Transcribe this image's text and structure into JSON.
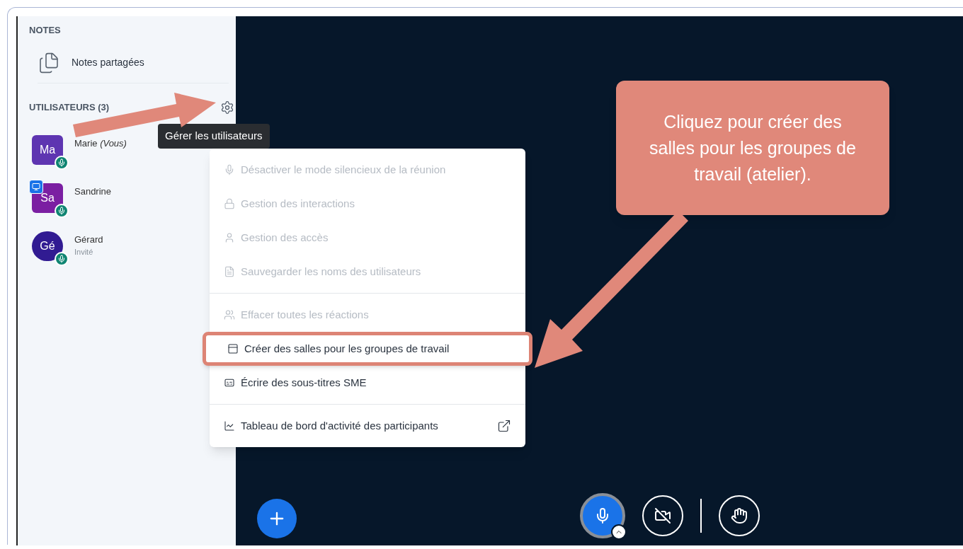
{
  "sidebar": {
    "notes_heading": "NOTES",
    "notes_item": "Notes partagées",
    "users_heading": "UTILISATEURS (3)",
    "users": [
      {
        "initials": "Ma",
        "name": "Marie *(Vous)*",
        "kind": "square",
        "color": "#5e35b1",
        "presenter": false
      },
      {
        "initials": "Sa",
        "name": "Sandrine",
        "kind": "square",
        "color": "#7b1fa2",
        "presenter": true
      },
      {
        "initials": "Gé",
        "name": "Gérard",
        "subtitle": "Invité",
        "kind": "circle",
        "color": "#311b92",
        "presenter": false
      }
    ]
  },
  "tooltip": "Gérer les utilisateurs",
  "menu": {
    "sections": [
      [
        {
          "label": "Désactiver le mode silencieux de la réunion",
          "dimmed": true,
          "highlighted": false,
          "external": false
        },
        {
          "label": "Gestion des interactions",
          "dimmed": true,
          "highlighted": false,
          "external": false
        },
        {
          "label": "Gestion des accès",
          "dimmed": true,
          "highlighted": false,
          "external": false
        },
        {
          "label": "Sauvegarder les noms des utilisateurs",
          "dimmed": true,
          "highlighted": false,
          "external": false
        }
      ],
      [
        {
          "label": "Effacer toutes les réactions",
          "dimmed": true,
          "highlighted": false,
          "external": false
        },
        {
          "label": "Créer des salles pour les groupes de travail",
          "dimmed": false,
          "highlighted": true,
          "external": false
        },
        {
          "label": "Écrire des sous-titres SME",
          "dimmed": false,
          "highlighted": false,
          "external": false
        }
      ],
      [
        {
          "label": "Tableau de bord d'activité des participants",
          "dimmed": false,
          "highlighted": false,
          "external": true
        }
      ]
    ]
  },
  "callout": "Cliquez pour créer des salles pour les groupes de travail (atelier)."
}
